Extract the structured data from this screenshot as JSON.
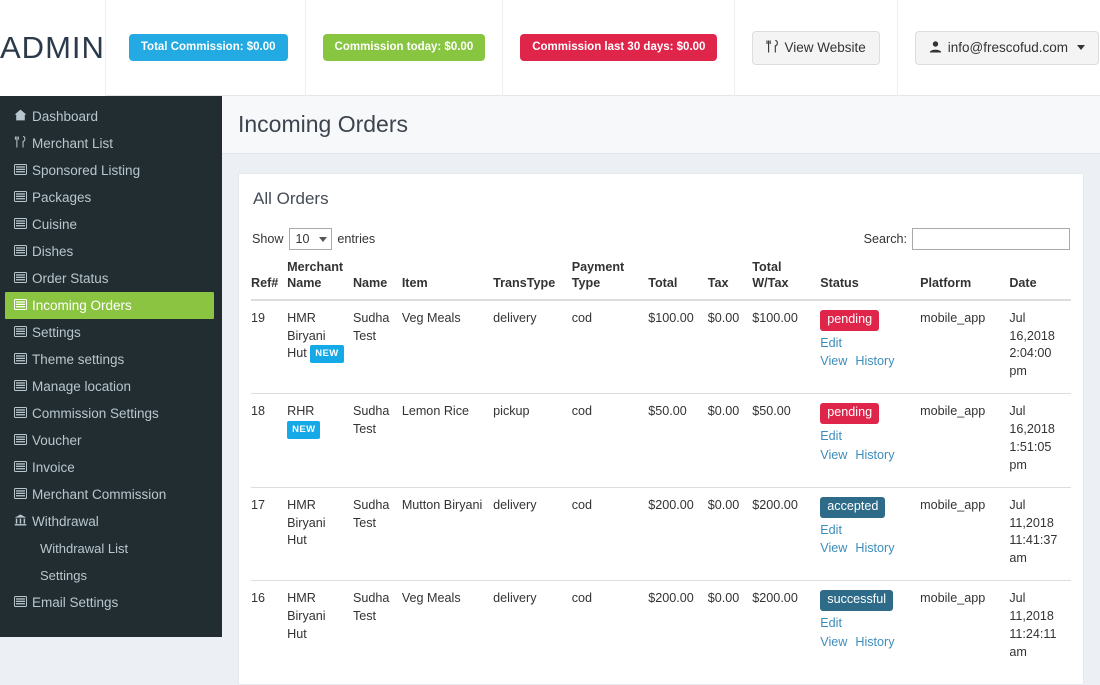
{
  "topbar": {
    "logo": "ADMIN",
    "badges": [
      {
        "label": "Total Commission: $0.00",
        "color": "#23aae2",
        "style": "blue"
      },
      {
        "label": "Commission today: $0.00",
        "color": "#88c541",
        "style": "green"
      },
      {
        "label": "Commission last 30 days: $0.00",
        "color": "#e0254b",
        "style": "red"
      }
    ],
    "view_website_label": "View Website",
    "view_website_icon": "cutlery-icon",
    "user_email": "info@frescofud.com",
    "user_icon": "user-icon"
  },
  "sidebar": {
    "items": [
      {
        "label": "Dashboard",
        "icon": "home-icon",
        "active": false,
        "sub": false
      },
      {
        "label": "Merchant List",
        "icon": "cutlery-icon",
        "active": false,
        "sub": false
      },
      {
        "label": "Sponsored Listing",
        "icon": "list-icon",
        "active": false,
        "sub": false
      },
      {
        "label": "Packages",
        "icon": "list-icon",
        "active": false,
        "sub": false
      },
      {
        "label": "Cuisine",
        "icon": "list-icon",
        "active": false,
        "sub": false
      },
      {
        "label": "Dishes",
        "icon": "list-icon",
        "active": false,
        "sub": false
      },
      {
        "label": "Order Status",
        "icon": "list-icon",
        "active": false,
        "sub": false
      },
      {
        "label": "Incoming Orders",
        "icon": "list-icon",
        "active": true,
        "sub": false
      },
      {
        "label": "Settings",
        "icon": "list-icon",
        "active": false,
        "sub": false
      },
      {
        "label": "Theme settings",
        "icon": "list-icon",
        "active": false,
        "sub": false
      },
      {
        "label": "Manage location",
        "icon": "list-icon",
        "active": false,
        "sub": false
      },
      {
        "label": "Commission Settings",
        "icon": "list-icon",
        "active": false,
        "sub": false
      },
      {
        "label": "Voucher",
        "icon": "list-icon",
        "active": false,
        "sub": false
      },
      {
        "label": "Invoice",
        "icon": "list-icon",
        "active": false,
        "sub": false
      },
      {
        "label": "Merchant Commission",
        "icon": "list-icon",
        "active": false,
        "sub": false
      },
      {
        "label": "Withdrawal",
        "icon": "bank-icon",
        "active": false,
        "sub": false
      },
      {
        "label": "Withdrawal List",
        "icon": "",
        "active": false,
        "sub": true
      },
      {
        "label": "Settings",
        "icon": "",
        "active": false,
        "sub": true
      },
      {
        "label": "Email Settings",
        "icon": "list-icon",
        "active": false,
        "sub": false
      }
    ],
    "active_color": "#8bc440"
  },
  "page": {
    "title": "Incoming Orders",
    "panel_title": "All Orders"
  },
  "table_controls": {
    "show_prefix": "Show",
    "show_value": "10",
    "show_suffix": "entries",
    "search_label": "Search:",
    "search_value": "",
    "search_placeholder": ""
  },
  "table": {
    "columns": [
      "Ref#",
      "Merchant Name",
      "Name",
      "Item",
      "TransType",
      "Payment Type",
      "Total",
      "Tax",
      "Total W/Tax",
      "Status",
      "Platform",
      "Date"
    ],
    "columns_split": [
      {
        "line1": "",
        "line2": "Ref#"
      },
      {
        "line1": "Merchant",
        "line2": "Name"
      },
      {
        "line1": "",
        "line2": "Name"
      },
      {
        "line1": "",
        "line2": "Item"
      },
      {
        "line1": "",
        "line2": "TransType"
      },
      {
        "line1": "Payment",
        "line2": "Type"
      },
      {
        "line1": "",
        "line2": "Total"
      },
      {
        "line1": "",
        "line2": "Tax"
      },
      {
        "line1": "Total",
        "line2": "W/Tax"
      },
      {
        "line1": "",
        "line2": "Status"
      },
      {
        "line1": "",
        "line2": "Platform"
      },
      {
        "line1": "",
        "line2": "Date"
      }
    ],
    "rows": [
      {
        "ref": "19",
        "merchant_name": "HMR Biryani Hut",
        "merchant_new": true,
        "new_badge_label": "NEW",
        "new_badge_inline": true,
        "name": "Sudha Test",
        "item": "Veg Meals",
        "trans_type": "delivery",
        "payment_type": "cod",
        "total": "$100.00",
        "tax": "$0.00",
        "total_wtax": "$100.00",
        "status": "pending",
        "status_style": "st-pending",
        "edit_label": "Edit",
        "view_label": "View",
        "history_label": "History",
        "platform": "mobile_app",
        "date": "Jul 16,2018 2:04:00 pm"
      },
      {
        "ref": "18",
        "merchant_name": "RHR",
        "merchant_new": true,
        "new_badge_label": "NEW",
        "new_badge_inline": false,
        "name": "Sudha Test",
        "item": "Lemon Rice",
        "trans_type": "pickup",
        "payment_type": "cod",
        "total": "$50.00",
        "tax": "$0.00",
        "total_wtax": "$50.00",
        "status": "pending",
        "status_style": "st-pending",
        "edit_label": "Edit",
        "view_label": "View",
        "history_label": "History",
        "platform": "mobile_app",
        "date": "Jul 16,2018 1:51:05 pm"
      },
      {
        "ref": "17",
        "merchant_name": "HMR Biryani Hut",
        "merchant_new": false,
        "new_badge_label": "",
        "new_badge_inline": false,
        "name": "Sudha Test",
        "item": "Mutton Biryani",
        "trans_type": "delivery",
        "payment_type": "cod",
        "total": "$200.00",
        "tax": "$0.00",
        "total_wtax": "$200.00",
        "status": "accepted",
        "status_style": "st-accepted",
        "edit_label": "Edit",
        "view_label": "View",
        "history_label": "History",
        "platform": "mobile_app",
        "date": "Jul 11,2018 11:41:37 am"
      },
      {
        "ref": "16",
        "merchant_name": "HMR Biryani Hut",
        "merchant_new": false,
        "new_badge_label": "",
        "new_badge_inline": false,
        "name": "Sudha Test",
        "item": "Veg Meals",
        "trans_type": "delivery",
        "payment_type": "cod",
        "total": "$200.00",
        "tax": "$0.00",
        "total_wtax": "$200.00",
        "status": "successful",
        "status_style": "st-successful",
        "edit_label": "Edit",
        "view_label": "View",
        "history_label": "History",
        "platform": "mobile_app",
        "date": "Jul 11,2018 11:24:11 am"
      }
    ]
  }
}
